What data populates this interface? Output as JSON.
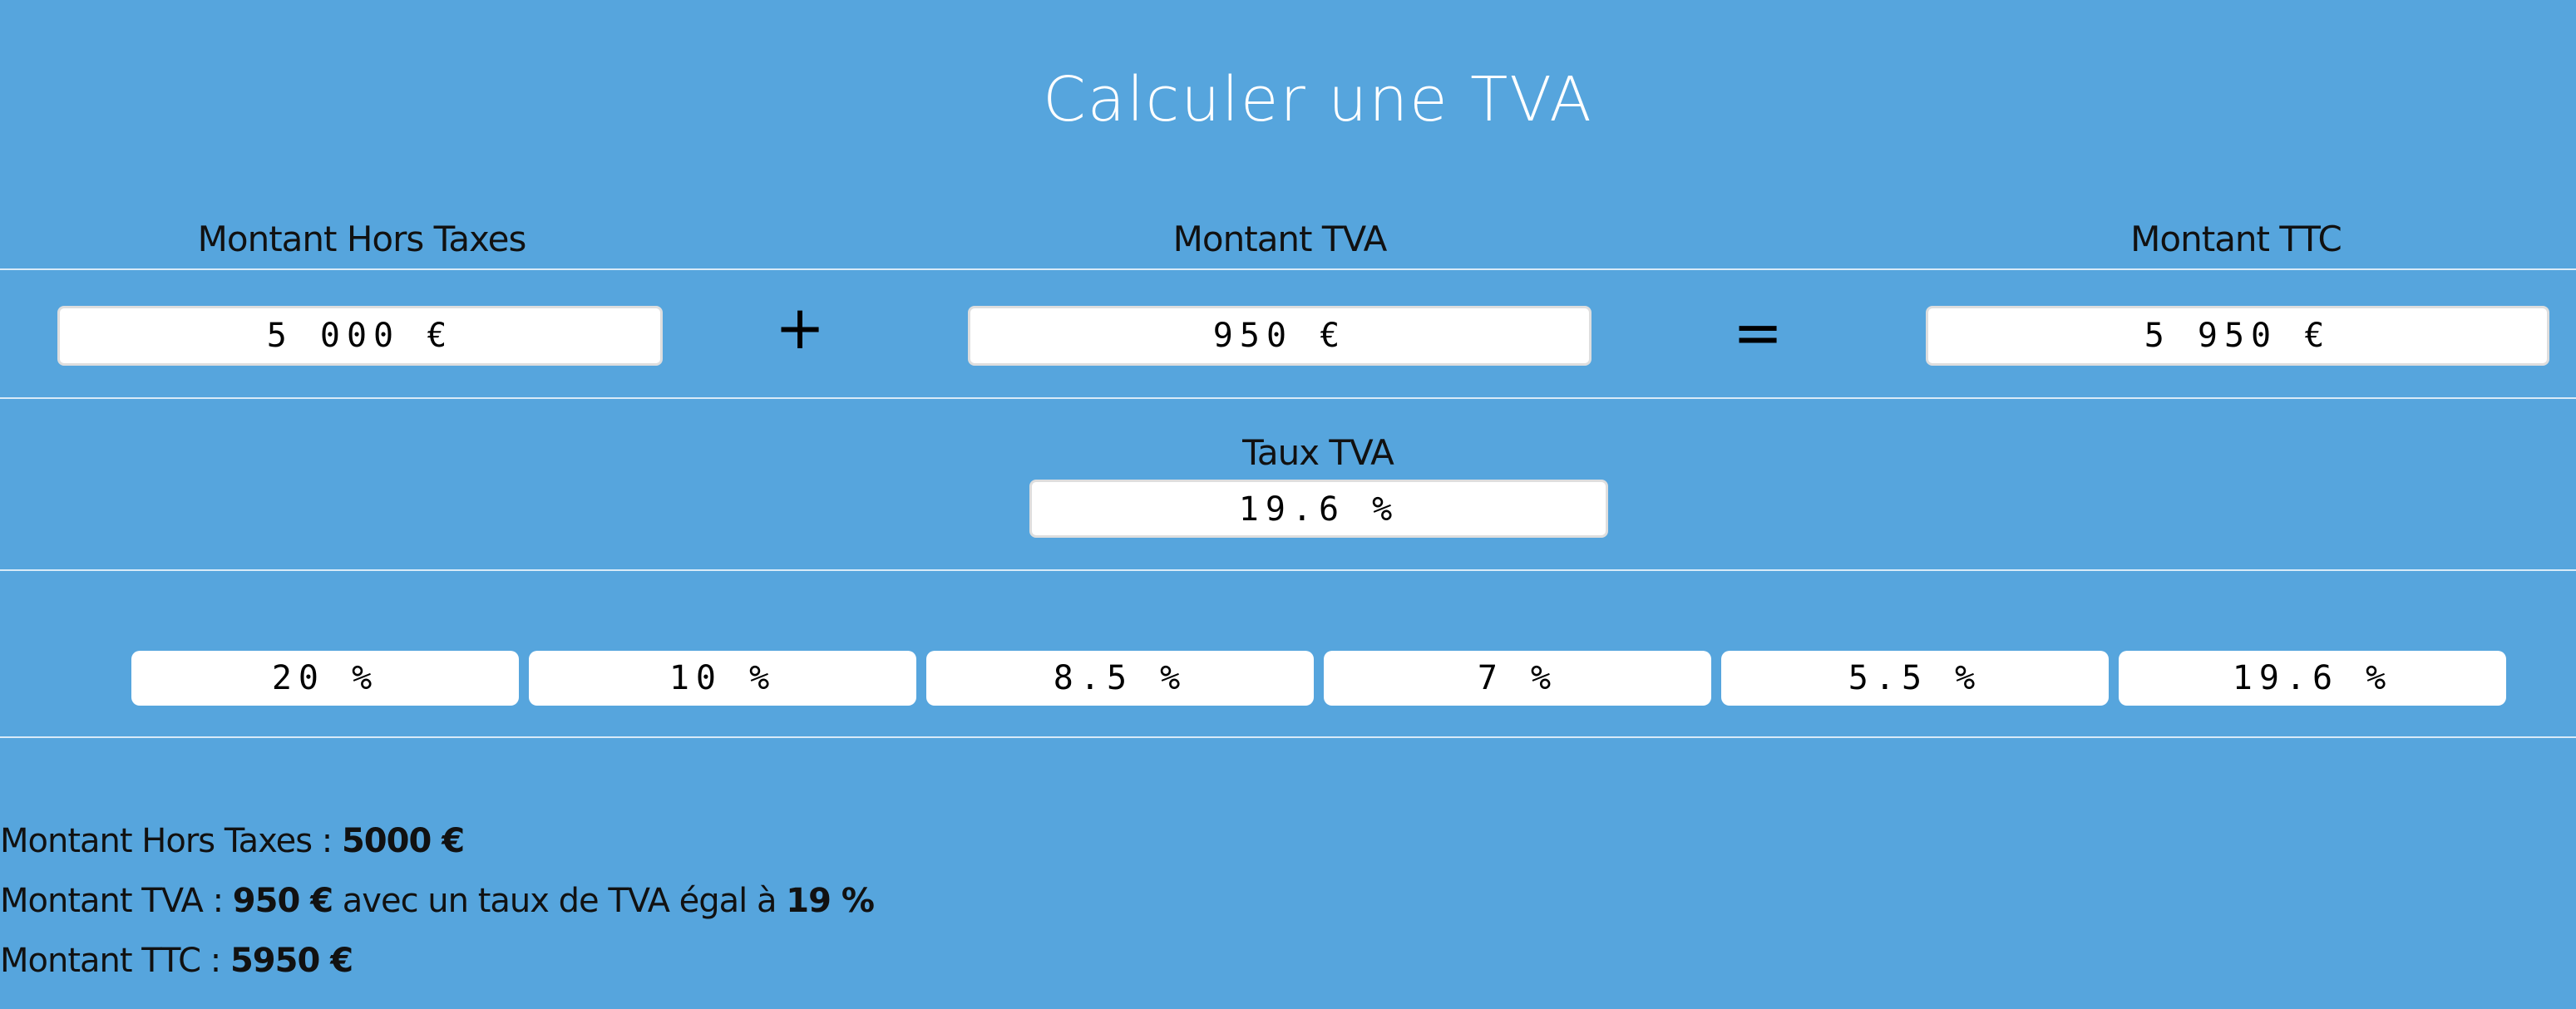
{
  "page": {
    "title": "Calculer une TVA"
  },
  "columns": {
    "ht_label": "Montant Hors Taxes",
    "tva_label": "Montant TVA",
    "ttc_label": "Montant TTC"
  },
  "operators": {
    "plus": "+",
    "equals": "="
  },
  "inputs": {
    "ht_value": "5 000 €",
    "tva_value": "950 €",
    "ttc_value": "5 950 €"
  },
  "rate": {
    "label": "Taux TVA",
    "value": "19.6 %"
  },
  "rate_buttons": [
    "20 %",
    "10 %",
    "8.5 %",
    "7 %",
    "5.5 %",
    "19.6 %"
  ],
  "summary": {
    "line1_prefix": "Montant Hors Taxes :",
    "line1_value": "5000 €",
    "line2_prefix": "Montant TVA :",
    "line2_value": "950 €",
    "line2_middle": "avec un taux de TVA égal à",
    "line2_rate": "19 %",
    "line3_prefix": "Montant TTC :",
    "line3_value": "5950 €"
  },
  "colors": {
    "background": "#56a5dd",
    "title": "#ffffff",
    "divider": "#d9ebf8",
    "field_background": "#ffffff"
  }
}
